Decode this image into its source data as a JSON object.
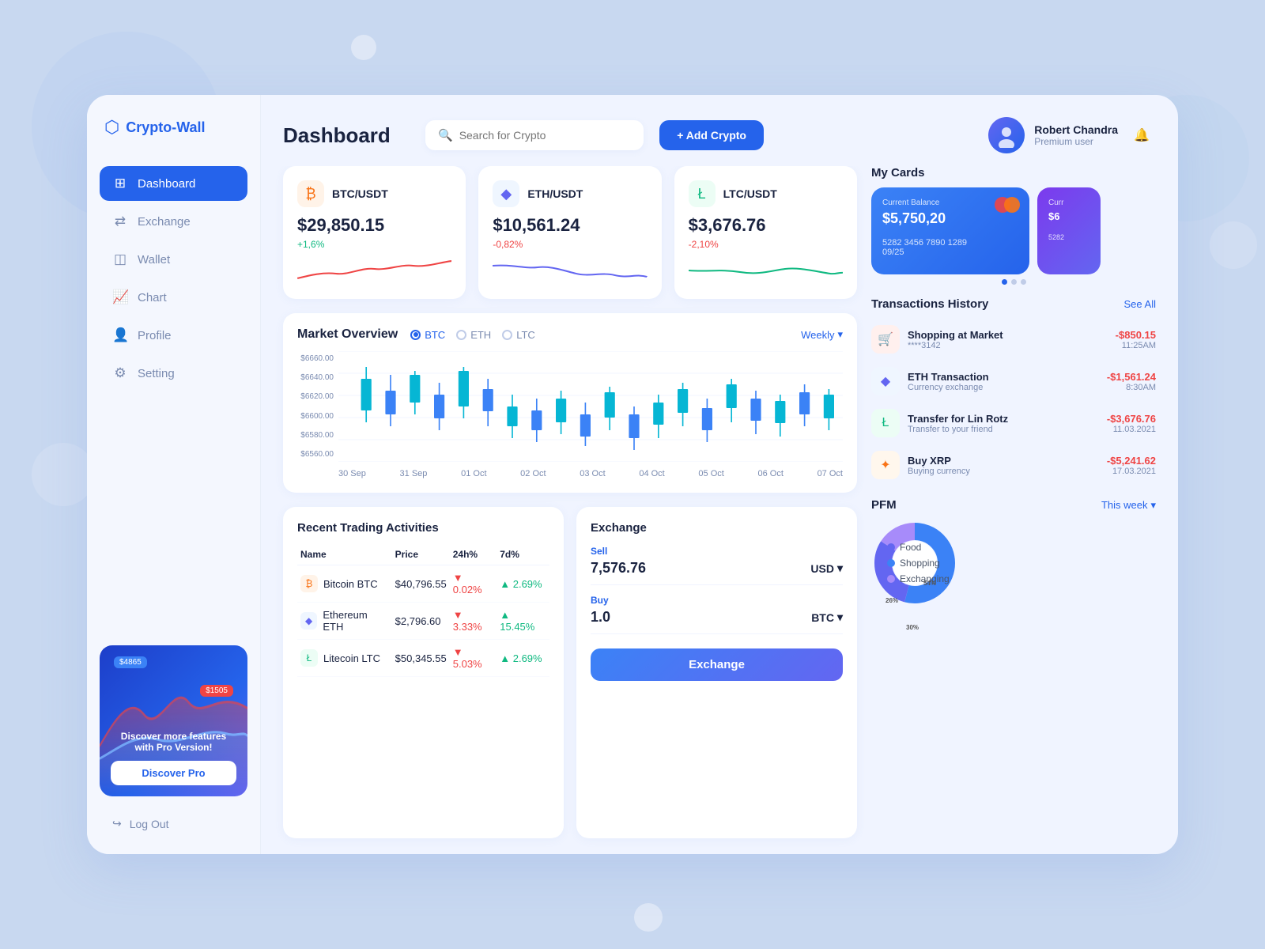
{
  "app": {
    "logo_text": "Crypto-Wall",
    "title": "Dashboard"
  },
  "sidebar": {
    "nav_items": [
      {
        "label": "Dashboard",
        "icon": "⊞",
        "active": true
      },
      {
        "label": "Exchange",
        "icon": "⇄"
      },
      {
        "label": "Wallet",
        "icon": "◫"
      },
      {
        "label": "Chart",
        "icon": "✎"
      },
      {
        "label": "Profile",
        "icon": "👤"
      },
      {
        "label": "Setting",
        "icon": "⚙"
      }
    ],
    "promo": {
      "label1": "$4865",
      "label2": "$1505",
      "text1": "Discover more features",
      "text2": "with ",
      "text_bold": "Pro Version",
      "text3": "!",
      "btn_label": "Discover Pro"
    },
    "logout_label": "Log Out"
  },
  "header": {
    "search_placeholder": "Search for Crypto",
    "add_btn_label": "+ Add Crypto"
  },
  "user": {
    "name": "Robert Chandra",
    "role": "Premium user"
  },
  "crypto_cards": [
    {
      "pair": "BTC/USDT",
      "icon": "₿",
      "icon_type": "btc",
      "price": "$29,850.15",
      "change": "+1,6%",
      "change_type": "pos"
    },
    {
      "pair": "ETH/USDT",
      "icon": "◆",
      "icon_type": "eth",
      "price": "$10,561.24",
      "change": "-0,82%",
      "change_type": "neg"
    },
    {
      "pair": "LTC/USDT",
      "icon": "Ł",
      "icon_type": "ltc",
      "price": "$3,676.76",
      "change": "-2,10%",
      "change_type": "neg"
    }
  ],
  "market_overview": {
    "title": "Market Overview",
    "tabs": [
      "BTC",
      "ETH",
      "LTC"
    ],
    "active_tab": "BTC",
    "period_label": "Weekly",
    "y_axis": [
      "$6660.00",
      "$6640.00",
      "$6620.00",
      "$6600.00",
      "$6580.00",
      "$6560.00"
    ],
    "x_axis": [
      "30 Sep",
      "31 Sep",
      "01 Oct",
      "02 Oct",
      "03 Oct",
      "04 Oct",
      "05 Oct",
      "06 Oct",
      "07 Oct"
    ]
  },
  "my_cards": {
    "title": "My Cards",
    "cards": [
      {
        "label": "Current Balance",
        "balance": "$5,750,20",
        "number": "5282 3456 7890 1289",
        "expiry": "09/25"
      },
      {
        "label": "Curr",
        "balance": "$6",
        "number": "5282"
      }
    ]
  },
  "transactions": {
    "title": "Transactions History",
    "see_all": "See All",
    "items": [
      {
        "icon": "🛒",
        "icon_type": "shop",
        "name": "Shopping at Market",
        "sub": "****3142",
        "amount": "-$850.15",
        "time": "11:25AM"
      },
      {
        "icon": "◆",
        "icon_type": "eth",
        "name": "ETH Transaction",
        "sub": "Currency exchange",
        "amount": "-$1,561.24",
        "time": "8:30AM"
      },
      {
        "icon": "Ł",
        "icon_type": "ltc",
        "name": "Transfer for Lin Rotz",
        "sub": "Transfer to your friend",
        "amount": "-$3,676.76",
        "time": "11.03.2021"
      },
      {
        "icon": "✦",
        "icon_type": "xrp",
        "name": "Buy XRP",
        "sub": "Buying currency",
        "amount": "-$5,241.62",
        "time": "17.03.2021"
      }
    ]
  },
  "pfm": {
    "title": "PFM",
    "period": "This week",
    "segments": [
      {
        "label": "Food",
        "color": "#6366f1",
        "value": 30,
        "percent": "30%"
      },
      {
        "label": "Shopping",
        "color": "#3b82f6",
        "value": 54,
        "percent": "54%"
      },
      {
        "label": "Exchanging",
        "color": "#a78bfa",
        "value": 26,
        "percent": "26%"
      }
    ]
  },
  "trading": {
    "title": "Recent Trading Activities",
    "columns": [
      "Name",
      "Price",
      "24h%",
      "7d%"
    ],
    "rows": [
      {
        "icon": "₿",
        "icon_type": "btc",
        "name": "Bitcoin BTC",
        "price": "$40,796.55",
        "change24": "0.02%",
        "change24_type": "neg",
        "change7d": "2.69%",
        "change7d_type": "pos"
      },
      {
        "icon": "◆",
        "icon_type": "eth",
        "name": "Ethereum ETH",
        "price": "$2,796.60",
        "change24": "3.33%",
        "change24_type": "neg",
        "change7d": "15.45%",
        "change7d_type": "pos"
      },
      {
        "icon": "Ł",
        "icon_type": "ltc",
        "name": "Litecoin LTC",
        "price": "$50,345.55",
        "change24": "5.03%",
        "change24_type": "neg",
        "change7d": "2.69%",
        "change7d_type": "pos"
      }
    ]
  },
  "exchange": {
    "title": "Exchange",
    "sell_label": "Sell",
    "sell_value": "7,576.76",
    "sell_currency": "USD",
    "buy_label": "Buy",
    "buy_value": "1.0",
    "buy_currency": "BTC",
    "btn_label": "Exchange"
  }
}
